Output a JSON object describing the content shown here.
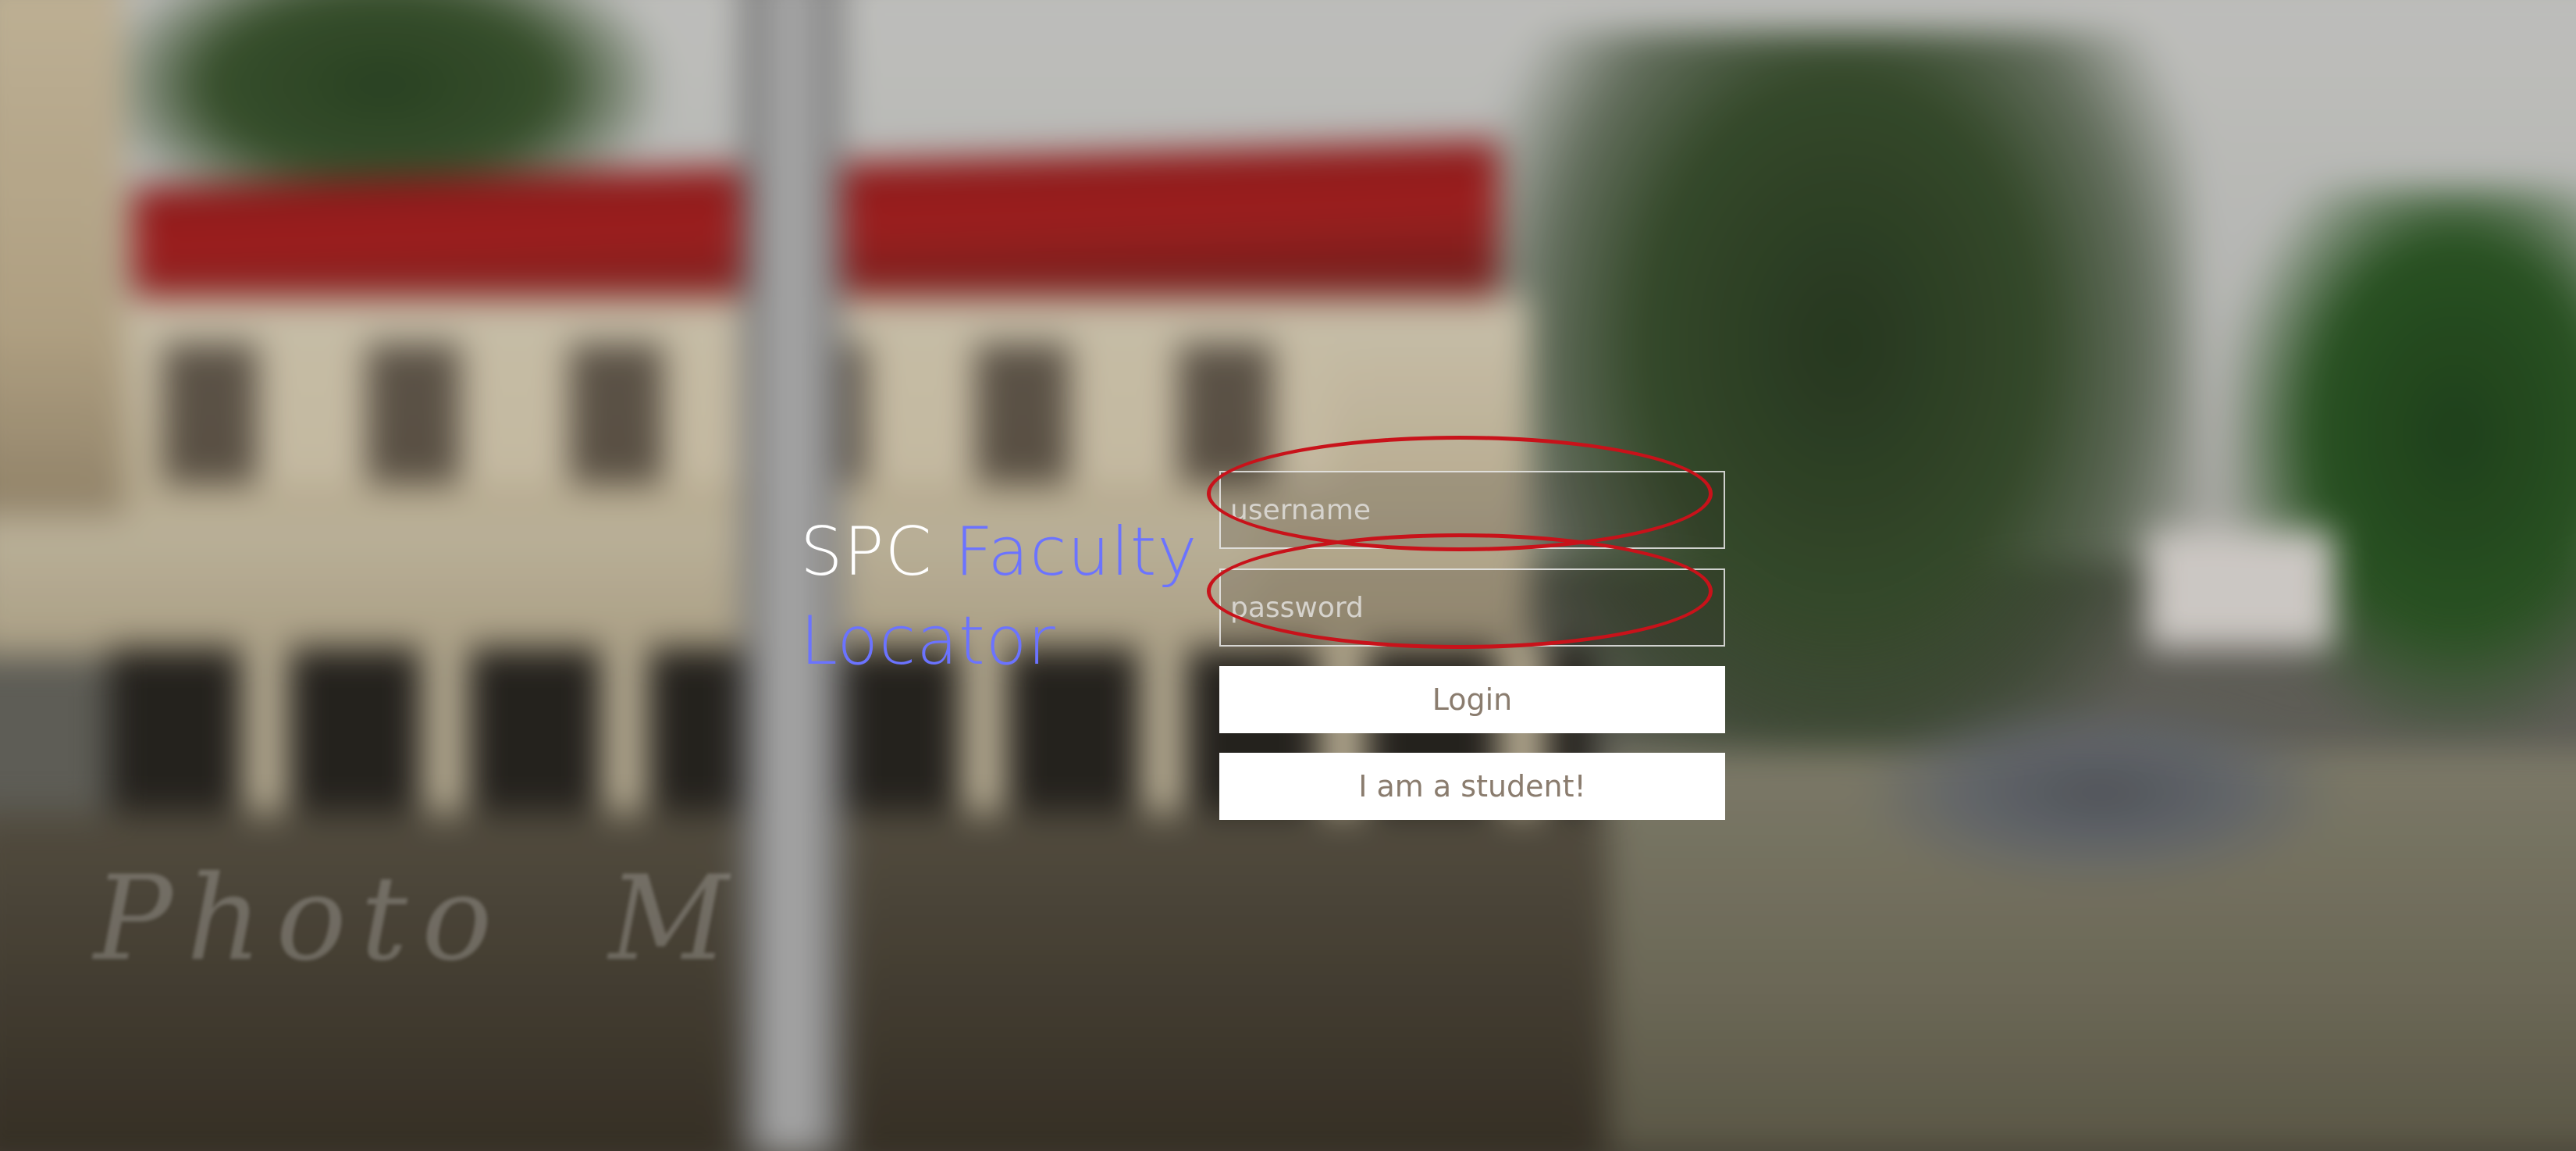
{
  "app": {
    "title_part1": "SPC",
    "title_part2": "Faculty",
    "title_part3": "Locator"
  },
  "login_form": {
    "username_placeholder": "username",
    "password_placeholder": "password",
    "login_label": "Login",
    "student_label": "I am a student!"
  },
  "colors": {
    "title_white": "#ffffff",
    "title_accent": "#6b73ff",
    "highlight_ring": "#c8121a",
    "button_text": "#8a7c6e"
  }
}
